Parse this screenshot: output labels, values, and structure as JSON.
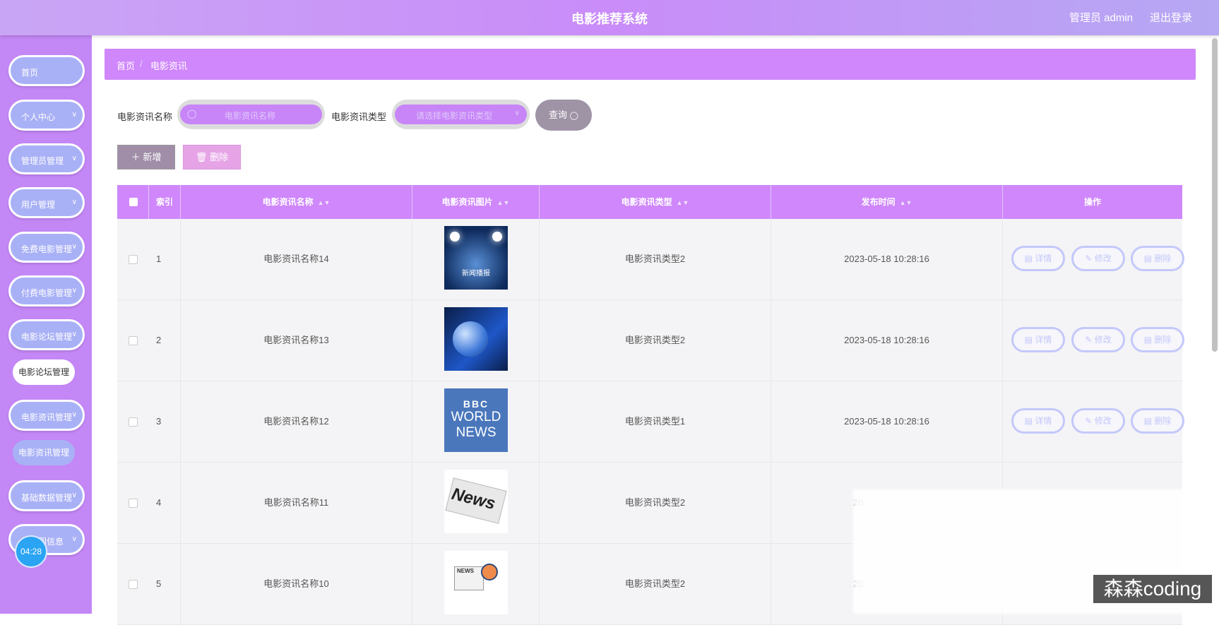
{
  "header": {
    "title": "电影推荐系统",
    "admin": "管理员 admin",
    "logout": "退出登录"
  },
  "sidebar": {
    "items": [
      {
        "label": "首页",
        "chevron": false
      },
      {
        "label": "个人中心",
        "chevron": true
      },
      {
        "label": "管理员管理",
        "chevron": true
      },
      {
        "label": "用户管理",
        "chevron": true
      },
      {
        "label": "免费电影管理",
        "chevron": true
      },
      {
        "label": "付费电影管理",
        "chevron": true
      },
      {
        "label": "电影论坛管理",
        "chevron": true
      },
      {
        "label": "电影资讯管理",
        "chevron": true
      },
      {
        "label": "基础数据管理",
        "chevron": true
      },
      {
        "label": "轮播图信息",
        "chevron": true
      }
    ],
    "sub_forum": "电影论坛管理",
    "sub_news": "电影资讯管理",
    "clock": "04:28"
  },
  "breadcrumb": {
    "home": "首页",
    "sep": "/",
    "current": "电影资讯"
  },
  "search": {
    "name_label": "电影资讯名称",
    "name_placeholder": "电影资讯名称",
    "type_label": "电影资讯类型",
    "type_placeholder": "请选择电影资讯类型",
    "query_label": "查询"
  },
  "toolbar": {
    "add_label": "新增",
    "delete_label": "删除"
  },
  "table": {
    "headers": [
      "索引",
      "电影资讯名称",
      "电影资讯图片",
      "电影资讯类型",
      "发布时间",
      "操作"
    ],
    "rows": [
      {
        "index": "1",
        "name": "电影资讯名称14",
        "type": "电影资讯类型2",
        "time": "2023-05-18 10:28:16"
      },
      {
        "index": "2",
        "name": "电影资讯名称13",
        "type": "电影资讯类型2",
        "time": "2023-05-18 10:28:16"
      },
      {
        "index": "3",
        "name": "电影资讯名称12",
        "type": "电影资讯类型1",
        "time": "2023-05-18 10:28:16"
      },
      {
        "index": "4",
        "name": "电影资讯名称11",
        "type": "电影资讯类型2",
        "time": "20"
      },
      {
        "index": "5",
        "name": "电影资讯名称10",
        "type": "电影资讯类型2",
        "time": "20"
      }
    ],
    "actions": {
      "detail": "详情",
      "edit": "修改",
      "delete": "删除"
    },
    "thumb_texts": {
      "r1": "新闻播报",
      "r3_a": "BBC",
      "r3_b": "WORLD",
      "r3_c": "NEWS",
      "r4": "News",
      "r5": "NEWS"
    }
  },
  "watermark": "森森coding",
  "colors": {
    "header": "#c98cf9",
    "sidebar": "#c487f6",
    "menu_pill": "#a9b1f6",
    "table_header": "#cf87fb"
  }
}
